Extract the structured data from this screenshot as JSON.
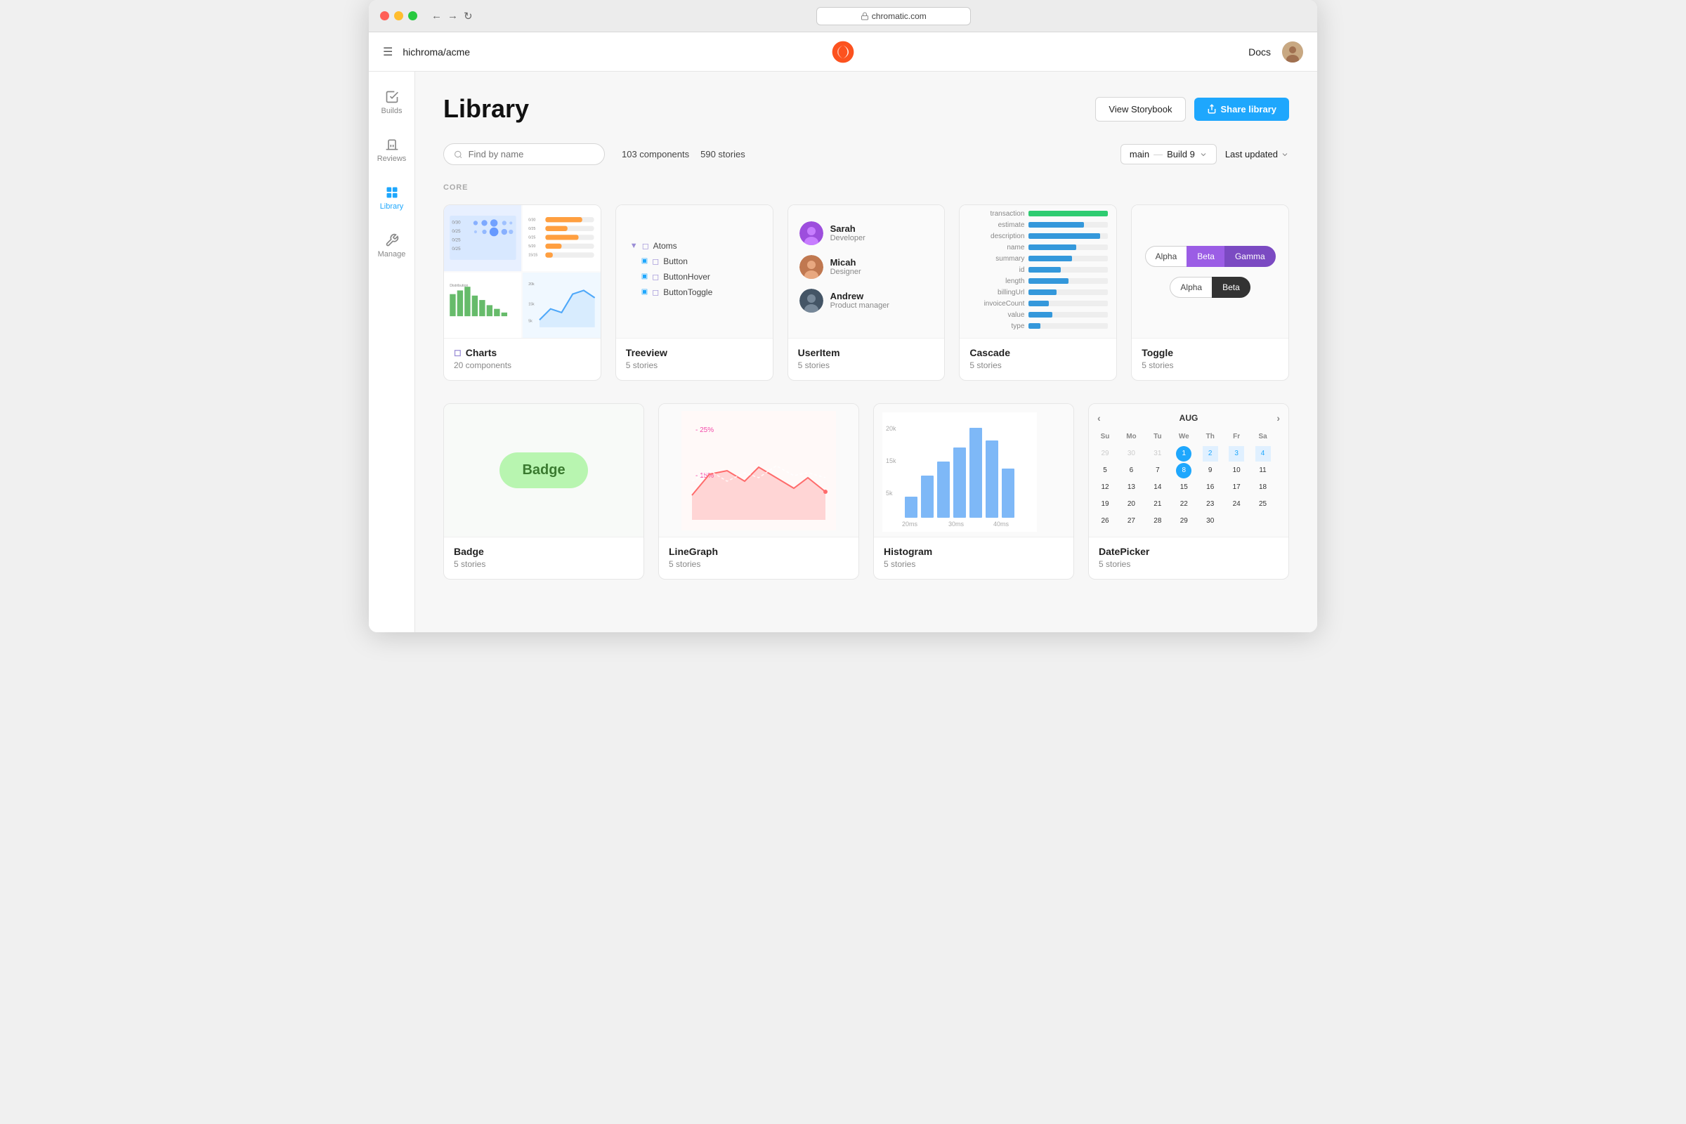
{
  "browser": {
    "url": "chromatic.com",
    "org": "hichroma/acme"
  },
  "header": {
    "docs_label": "Docs",
    "logo_title": "Chromatic"
  },
  "sidebar": {
    "items": [
      {
        "id": "builds",
        "label": "Builds",
        "icon": "builds-icon"
      },
      {
        "id": "reviews",
        "label": "Reviews",
        "icon": "reviews-icon"
      },
      {
        "id": "library",
        "label": "Library",
        "icon": "library-icon",
        "active": true
      },
      {
        "id": "manage",
        "label": "Manage",
        "icon": "manage-icon"
      }
    ]
  },
  "page": {
    "title": "Library",
    "view_storybook_label": "View Storybook",
    "share_library_label": "Share library"
  },
  "toolbar": {
    "search_placeholder": "Find by name",
    "components_count": "103 components",
    "stories_count": "590 stories",
    "branch_label": "main",
    "build_label": "Build 9",
    "sort_label": "Last updated"
  },
  "sections": [
    {
      "id": "core",
      "label": "CORE",
      "components": [
        {
          "id": "charts",
          "name": "Charts",
          "stories": "20 components",
          "has_folder_icon": true,
          "type": "charts"
        },
        {
          "id": "treeview",
          "name": "Treeview",
          "stories": "5 stories",
          "type": "treeview"
        },
        {
          "id": "useritem",
          "name": "UserItem",
          "stories": "5 stories",
          "type": "useritem",
          "users": [
            {
              "name": "Sarah",
              "role": "Developer",
              "color": "#c09"
            },
            {
              "name": "Micah",
              "role": "Designer",
              "color": "#cc6633"
            },
            {
              "name": "Andrew",
              "role": "Product manager",
              "color": "#557"
            }
          ]
        },
        {
          "id": "cascade",
          "name": "Cascade",
          "stories": "5 stories",
          "type": "cascade"
        },
        {
          "id": "toggle",
          "name": "Toggle",
          "stories": "5 stories",
          "type": "toggle"
        }
      ]
    },
    {
      "id": "core2",
      "label": "",
      "components": [
        {
          "id": "badge",
          "name": "Badge",
          "stories": "5 stories",
          "type": "badge"
        },
        {
          "id": "linegraph",
          "name": "LineGraph",
          "stories": "5 stories",
          "type": "linegraph"
        },
        {
          "id": "histogram",
          "name": "Histogram",
          "stories": "5 stories",
          "type": "histogram"
        },
        {
          "id": "datepicker",
          "name": "DatePicker",
          "stories": "5 stories",
          "type": "datepicker"
        }
      ]
    }
  ]
}
